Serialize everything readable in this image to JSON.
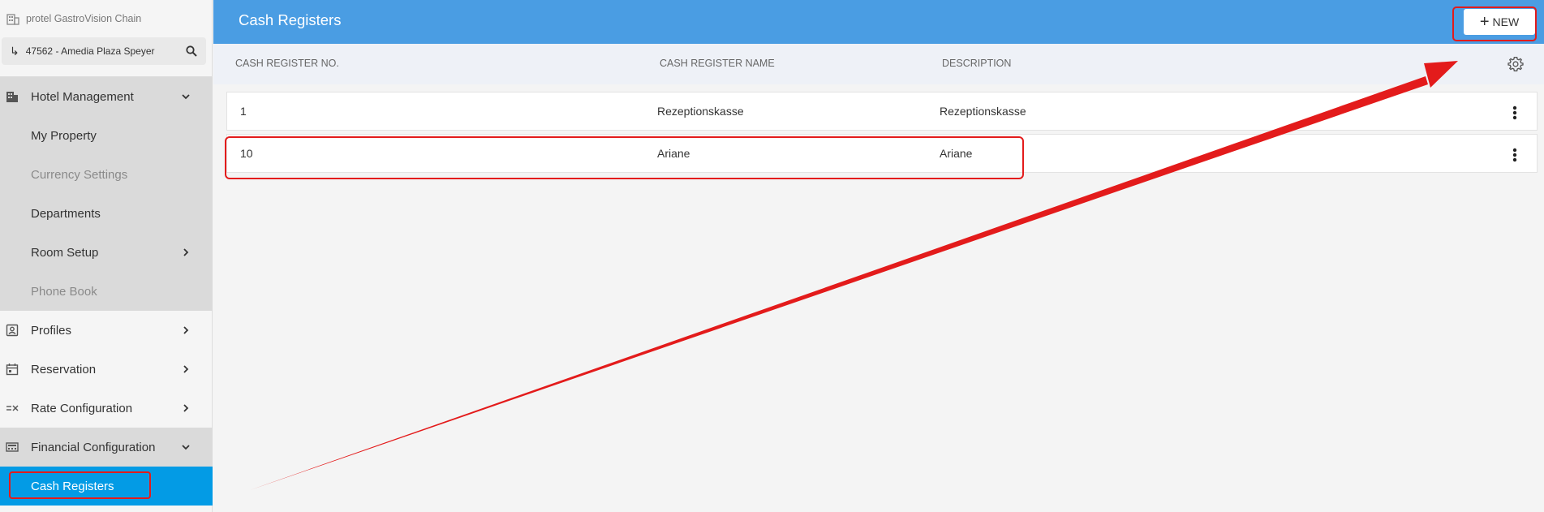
{
  "sidebar": {
    "chain_name": "protel GastroVision Chain",
    "property": "47562 - Amedia Plaza Speyer",
    "items": [
      {
        "label": "Hotel Management",
        "icon": "building-icon"
      },
      {
        "label": "My Property"
      },
      {
        "label": "Currency Settings"
      },
      {
        "label": "Departments"
      },
      {
        "label": "Room Setup"
      },
      {
        "label": "Phone Book"
      },
      {
        "label": "Profiles",
        "icon": "contact-card-icon"
      },
      {
        "label": "Reservation",
        "icon": "calendar-icon"
      },
      {
        "label": "Rate Configuration",
        "icon": "rate-config-icon"
      },
      {
        "label": "Financial Configuration",
        "icon": "cash-register-icon"
      },
      {
        "label": "Cash Registers"
      }
    ]
  },
  "header": {
    "title": "Cash Registers",
    "new_label": "NEW"
  },
  "table": {
    "columns": [
      "CASH REGISTER NO.",
      "CASH REGISTER NAME",
      "DESCRIPTION"
    ],
    "rows": [
      {
        "no": "1",
        "name": "Rezeptionskasse",
        "description": "Rezeptionskasse"
      },
      {
        "no": "10",
        "name": "Ariane",
        "description": "Ariane"
      }
    ]
  },
  "colors": {
    "header_blue": "#4a9de3",
    "active_blue": "#039be5",
    "annotation_red": "#e31b1b"
  }
}
